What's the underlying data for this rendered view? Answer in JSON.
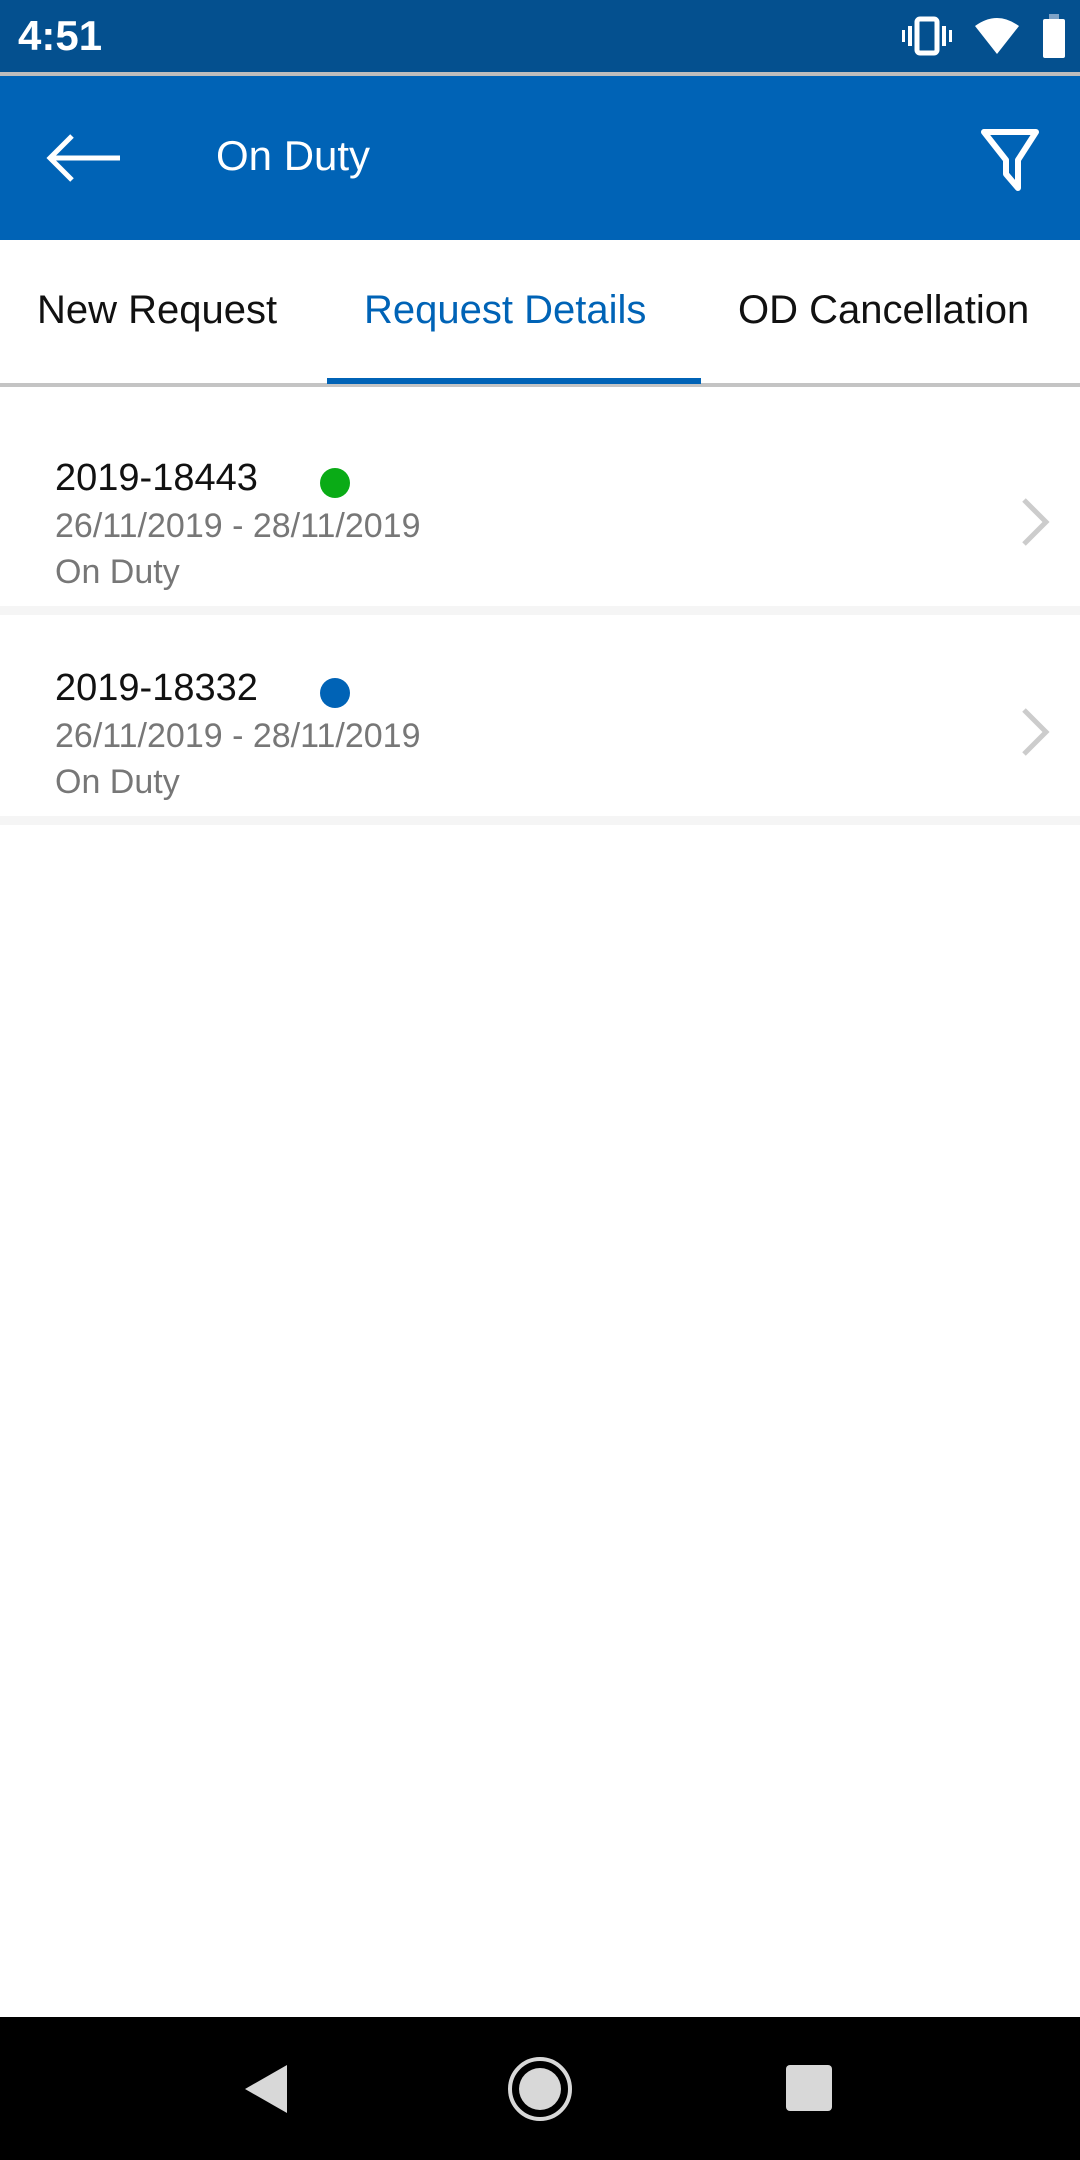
{
  "status_bar": {
    "time": "4:51",
    "icons": [
      "vibrate-icon",
      "wifi-icon",
      "battery-icon"
    ]
  },
  "app_bar": {
    "title": "On Duty",
    "back_icon": "arrow-left-icon",
    "filter_icon": "filter-icon"
  },
  "tabs": [
    {
      "label": "New Request",
      "active": false
    },
    {
      "label": "Request Details",
      "active": true
    },
    {
      "label": "OD Cancellation",
      "active": false
    }
  ],
  "requests": [
    {
      "id": "2019-18443",
      "status_color": "#0aab16",
      "dates": "26/11/2019 - 28/11/2019",
      "type": "On Duty"
    },
    {
      "id": "2019-18332",
      "status_color": "#0063b6",
      "dates": "26/11/2019 - 28/11/2019",
      "type": "On Duty"
    }
  ],
  "colors": {
    "primary": "#0063b6",
    "status_bar": "#04508f"
  },
  "nav_bar": {
    "icons": [
      "back-triangle-icon",
      "home-circle-icon",
      "recents-square-icon"
    ]
  }
}
